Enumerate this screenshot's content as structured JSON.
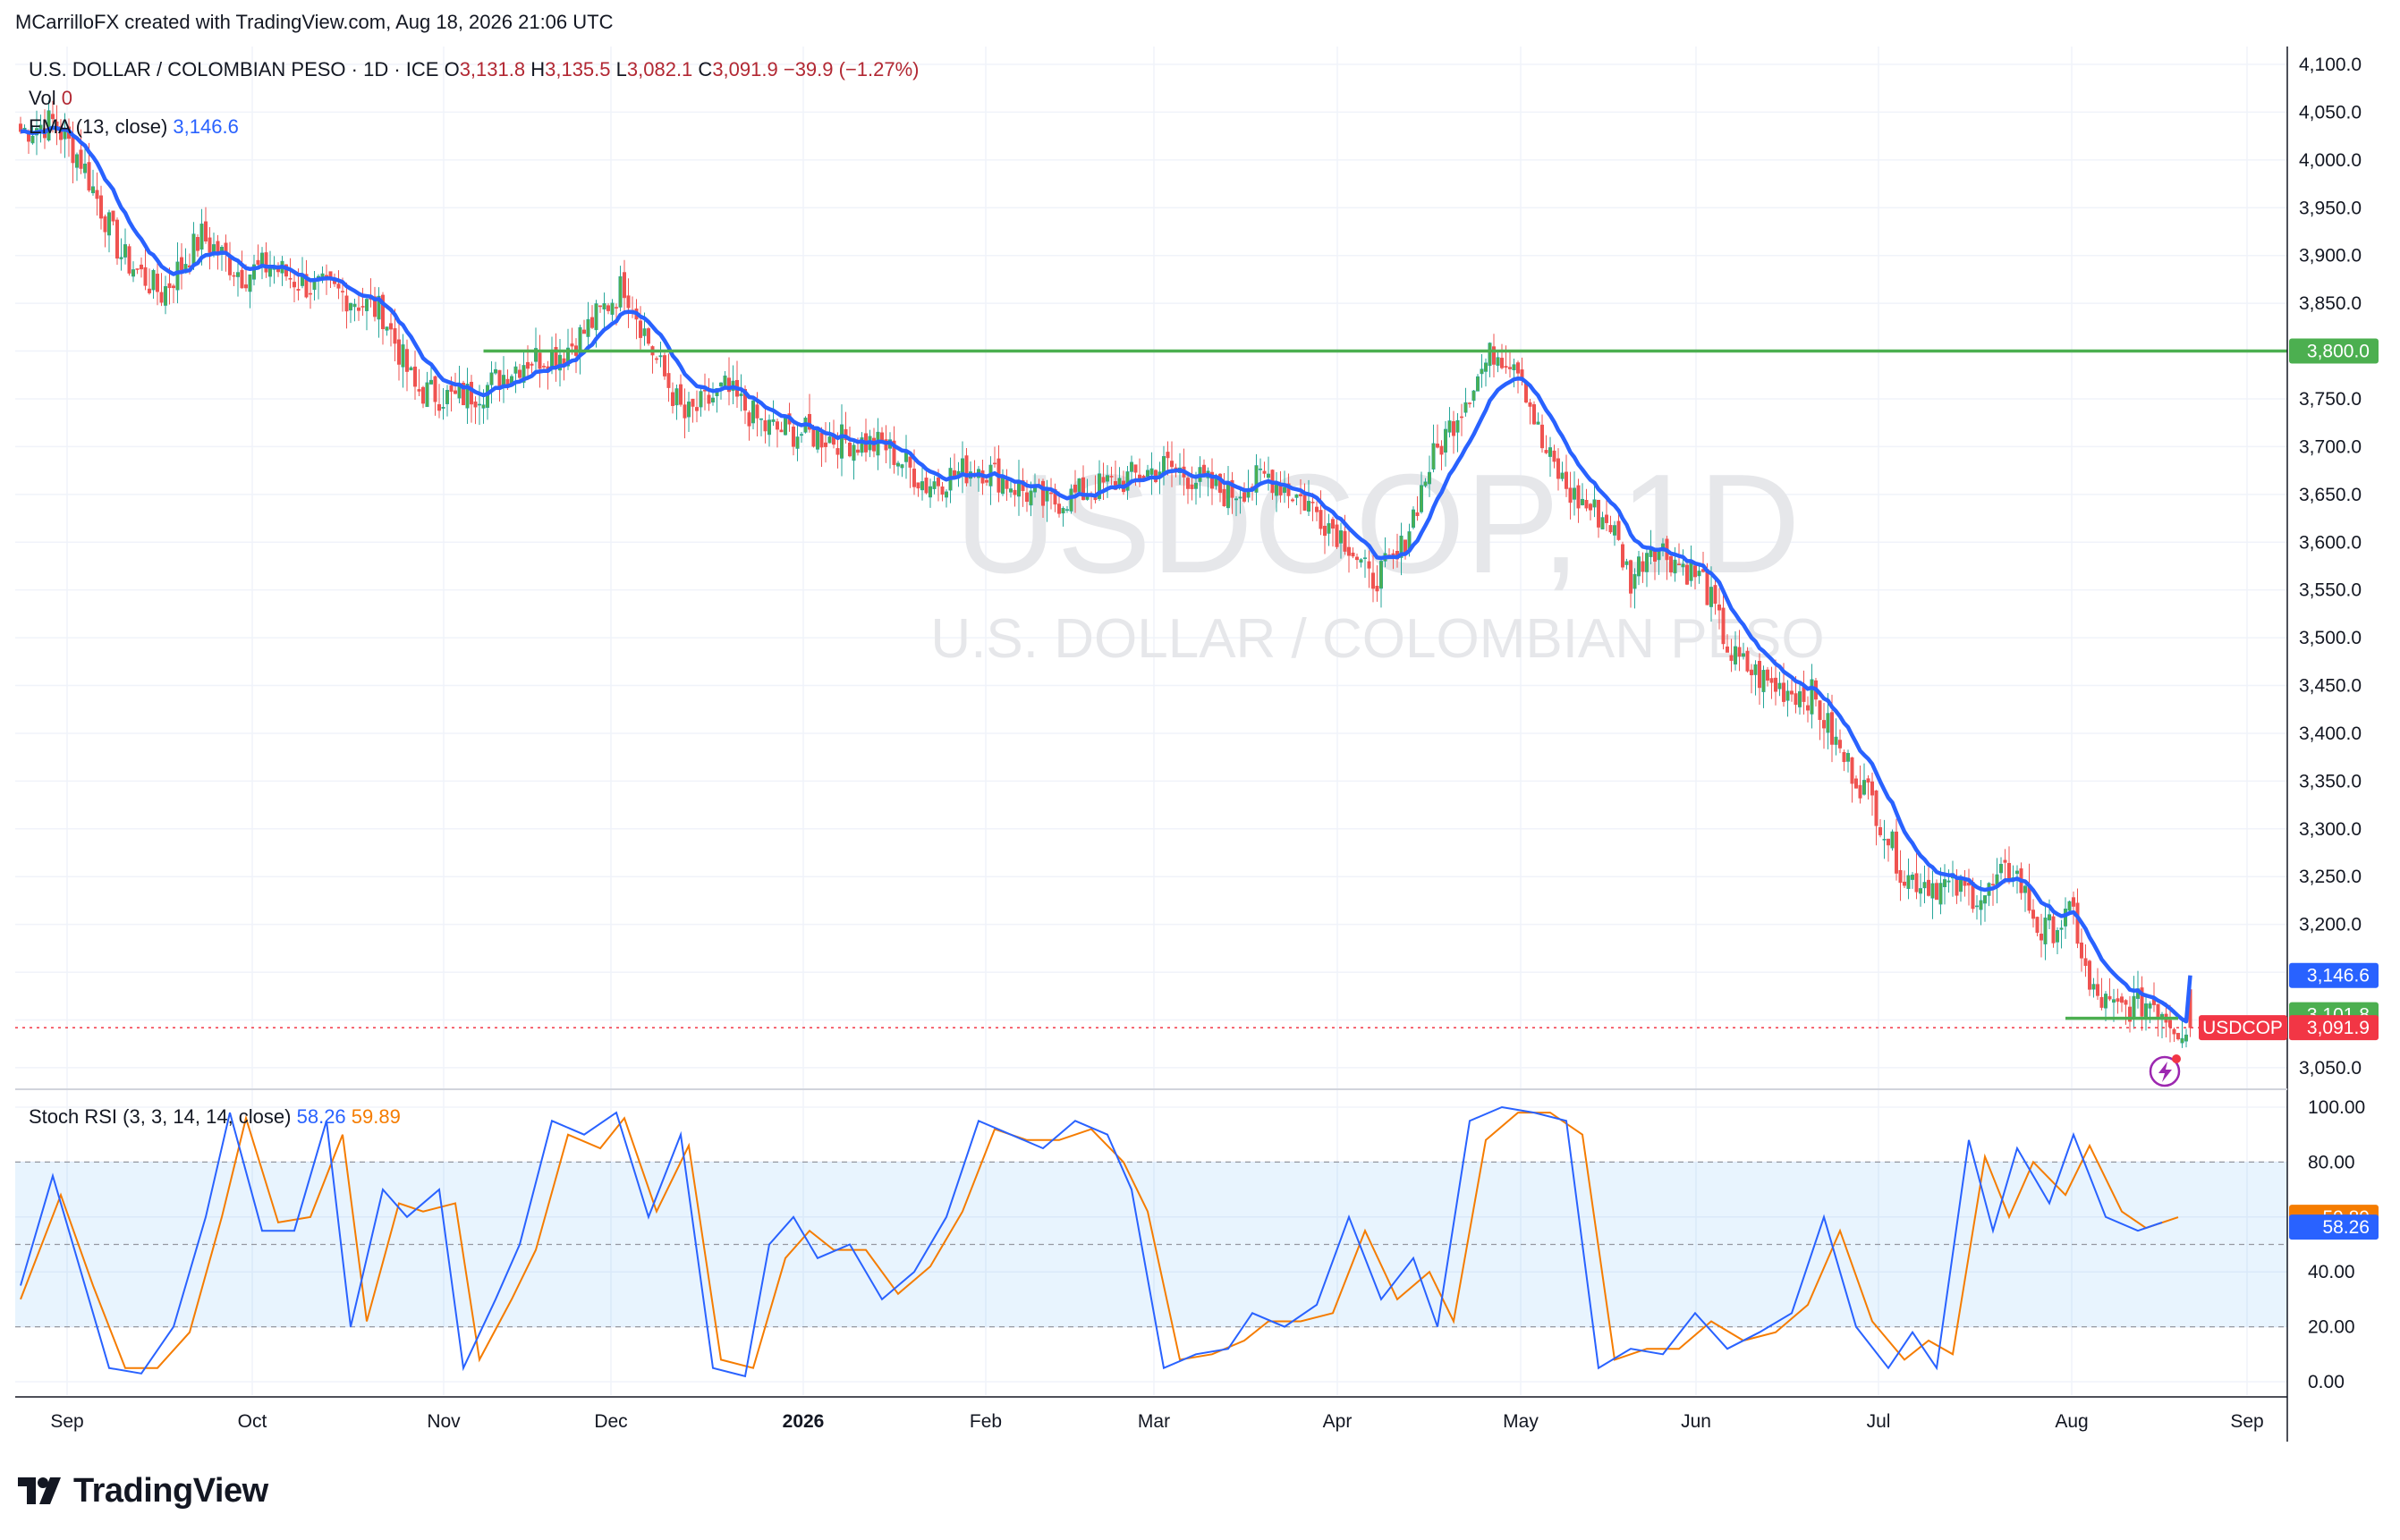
{
  "header": {
    "author_line": "MCarrilloFX created with TradingView.com, Aug 18, 2026 21:06 UTC"
  },
  "legend": {
    "symbol_line": "U.S. DOLLAR / COLOMBIAN PESO · 1D · ICE",
    "open_label": "O",
    "open": "3,131.8",
    "high_label": "H",
    "high": "3,135.5",
    "low_label": "L",
    "low": "3,082.1",
    "close_label": "C",
    "close": "3,091.9",
    "change": "−39.9 (−1.27%)",
    "vol_label": "Vol",
    "vol_value": "0",
    "ema_label": "EMA (13, close)",
    "ema_value": "3,146.6"
  },
  "watermark": {
    "symbol": "USDCOP, 1D",
    "name": "U.S. DOLLAR / COLOMBIAN PESO"
  },
  "price_axis": {
    "ticks": [
      "4,100.0",
      "4,050.0",
      "4,000.0",
      "3,950.0",
      "3,900.0",
      "3,850.0",
      "3,800.0",
      "3,750.0",
      "3,700.0",
      "3,650.0",
      "3,600.0",
      "3,550.0",
      "3,500.0",
      "3,450.0",
      "3,400.0",
      "3,350.0",
      "3,300.0",
      "3,250.0",
      "3,200.0",
      "3,150.0",
      "3,100.0",
      "3,050.0"
    ],
    "resistance_label": "3,800.0",
    "ema_label": "3,146.6",
    "support_label": "3,101.8",
    "price_tag_symbol": "USDCOP",
    "price_tag_value": "3,091.9"
  },
  "stoch": {
    "label": "Stoch RSI (3, 3, 14, 14, close)",
    "k_value": "58.26",
    "d_value": "59.89",
    "ticks": [
      "100.00",
      "80.00",
      "60.00",
      "40.00",
      "20.00",
      "0.00"
    ],
    "k_tag": "58.26",
    "d_tag": "59.89"
  },
  "time_axis": {
    "labels": [
      "Sep",
      "Oct",
      "Nov",
      "Dec",
      "2026",
      "Feb",
      "Mar",
      "Apr",
      "May",
      "Jun",
      "Jul",
      "Aug",
      "Sep"
    ]
  },
  "colors": {
    "up": "#26a69a",
    "up_fill": "#4caf50",
    "down": "#ef5350",
    "ema": "#2962ff",
    "level": "#4caf50",
    "k": "#2962ff",
    "d": "#f57c00",
    "price_tag": "#f23645"
  },
  "brand": "TradingView",
  "chart_data": [
    {
      "type": "candlestick",
      "title": "U.S. DOLLAR / COLOMBIAN PESO · 1D · ICE",
      "xlabel": "",
      "ylabel": "",
      "x_labels": [
        "Sep",
        "Oct",
        "Nov",
        "Dec",
        "2026",
        "Feb",
        "Mar",
        "Apr",
        "May",
        "Jun",
        "Jul",
        "Aug",
        "Sep"
      ],
      "ylim": [
        3018,
        4120
      ],
      "close_path": [
        [
          0,
          4030
        ],
        [
          8,
          4040
        ],
        [
          15,
          4000
        ],
        [
          25,
          3900
        ],
        [
          35,
          3860
        ],
        [
          45,
          3920
        ],
        [
          55,
          3880
        ],
        [
          62,
          3890
        ],
        [
          70,
          3870
        ],
        [
          80,
          3860
        ],
        [
          90,
          3840
        ],
        [
          98,
          3760
        ],
        [
          108,
          3750
        ],
        [
          115,
          3760
        ],
        [
          125,
          3790
        ],
        [
          135,
          3800
        ],
        [
          140,
          3820
        ],
        [
          150,
          3870
        ],
        [
          158,
          3790
        ],
        [
          165,
          3730
        ],
        [
          175,
          3760
        ],
        [
          185,
          3720
        ],
        [
          200,
          3710
        ],
        [
          215,
          3700
        ],
        [
          225,
          3660
        ],
        [
          238,
          3680
        ],
        [
          255,
          3640
        ],
        [
          270,
          3660
        ],
        [
          285,
          3680
        ],
        [
          300,
          3650
        ],
        [
          310,
          3670
        ],
        [
          320,
          3640
        ],
        [
          330,
          3600
        ],
        [
          335,
          3560
        ],
        [
          342,
          3580
        ],
        [
          350,
          3680
        ],
        [
          360,
          3760
        ],
        [
          366,
          3800
        ],
        [
          372,
          3790
        ],
        [
          378,
          3700
        ],
        [
          385,
          3650
        ],
        [
          395,
          3620
        ],
        [
          400,
          3560
        ],
        [
          405,
          3600
        ],
        [
          418,
          3560
        ],
        [
          425,
          3480
        ],
        [
          435,
          3450
        ],
        [
          445,
          3440
        ],
        [
          452,
          3380
        ],
        [
          460,
          3330
        ],
        [
          468,
          3250
        ],
        [
          478,
          3240
        ],
        [
          488,
          3230
        ],
        [
          495,
          3260
        ],
        [
          502,
          3190
        ],
        [
          510,
          3210
        ],
        [
          514,
          3130
        ],
        [
          520,
          3110
        ],
        [
          530,
          3120
        ],
        [
          536,
          3092
        ]
      ],
      "ema_13": {
        "last": 3146.6
      },
      "last": {
        "open": 3131.8,
        "high": 3135.5,
        "low": 3082.1,
        "close": 3091.9,
        "change": -39.9,
        "change_pct": -1.27
      },
      "levels": [
        {
          "name": "resistance",
          "value": 3800.0
        },
        {
          "name": "support",
          "value": 3101.8
        }
      ]
    },
    {
      "type": "line",
      "title": "Stoch RSI (3, 3, 14, 14, close)",
      "ylim": [
        0,
        100
      ],
      "bands": [
        20,
        50,
        80
      ],
      "series": [
        {
          "name": "K",
          "last": 58.26,
          "values": [
            [
              0,
              35
            ],
            [
              8,
              75
            ],
            [
              14,
              45
            ],
            [
              22,
              5
            ],
            [
              30,
              3
            ],
            [
              38,
              20
            ],
            [
              46,
              60
            ],
            [
              52,
              98
            ],
            [
              60,
              55
            ],
            [
              68,
              55
            ],
            [
              76,
              95
            ],
            [
              82,
              20
            ],
            [
              90,
              70
            ],
            [
              96,
              60
            ],
            [
              104,
              70
            ],
            [
              110,
              5
            ],
            [
              118,
              30
            ],
            [
              124,
              50
            ],
            [
              132,
              95
            ],
            [
              140,
              90
            ],
            [
              148,
              98
            ],
            [
              156,
              60
            ],
            [
              164,
              90
            ],
            [
              172,
              5
            ],
            [
              180,
              2
            ],
            [
              186,
              50
            ],
            [
              192,
              60
            ],
            [
              198,
              45
            ],
            [
              206,
              50
            ],
            [
              214,
              30
            ],
            [
              222,
              40
            ],
            [
              230,
              60
            ],
            [
              238,
              95
            ],
            [
              246,
              90
            ],
            [
              254,
              85
            ],
            [
              262,
              95
            ],
            [
              270,
              90
            ],
            [
              276,
              70
            ],
            [
              284,
              5
            ],
            [
              292,
              10
            ],
            [
              300,
              12
            ],
            [
              306,
              25
            ],
            [
              314,
              20
            ],
            [
              322,
              28
            ],
            [
              330,
              60
            ],
            [
              338,
              30
            ],
            [
              346,
              45
            ],
            [
              352,
              20
            ],
            [
              360,
              95
            ],
            [
              368,
              100
            ],
            [
              376,
              98
            ],
            [
              384,
              95
            ],
            [
              392,
              5
            ],
            [
              400,
              12
            ],
            [
              408,
              10
            ],
            [
              416,
              25
            ],
            [
              424,
              12
            ],
            [
              432,
              18
            ],
            [
              440,
              25
            ],
            [
              448,
              60
            ],
            [
              456,
              20
            ],
            [
              464,
              5
            ],
            [
              470,
              18
            ],
            [
              476,
              5
            ],
            [
              484,
              88
            ],
            [
              490,
              55
            ],
            [
              496,
              85
            ],
            [
              504,
              65
            ],
            [
              510,
              90
            ],
            [
              518,
              60
            ],
            [
              526,
              55
            ],
            [
              532,
              58
            ]
          ]
        },
        {
          "name": "D",
          "last": 59.89,
          "values": [
            [
              0,
              30
            ],
            [
              10,
              68
            ],
            [
              18,
              35
            ],
            [
              26,
              5
            ],
            [
              34,
              5
            ],
            [
              42,
              18
            ],
            [
              50,
              60
            ],
            [
              56,
              96
            ],
            [
              64,
              58
            ],
            [
              72,
              60
            ],
            [
              80,
              90
            ],
            [
              86,
              22
            ],
            [
              94,
              65
            ],
            [
              100,
              62
            ],
            [
              108,
              65
            ],
            [
              114,
              8
            ],
            [
              122,
              30
            ],
            [
              128,
              48
            ],
            [
              136,
              90
            ],
            [
              144,
              85
            ],
            [
              150,
              96
            ],
            [
              158,
              62
            ],
            [
              166,
              86
            ],
            [
              174,
              8
            ],
            [
              182,
              5
            ],
            [
              190,
              45
            ],
            [
              196,
              55
            ],
            [
              202,
              48
            ],
            [
              210,
              48
            ],
            [
              218,
              32
            ],
            [
              226,
              42
            ],
            [
              234,
              62
            ],
            [
              242,
              92
            ],
            [
              250,
              88
            ],
            [
              258,
              88
            ],
            [
              266,
              92
            ],
            [
              274,
              80
            ],
            [
              280,
              62
            ],
            [
              288,
              8
            ],
            [
              296,
              10
            ],
            [
              304,
              15
            ],
            [
              310,
              22
            ],
            [
              318,
              22
            ],
            [
              326,
              25
            ],
            [
              334,
              55
            ],
            [
              342,
              30
            ],
            [
              350,
              40
            ],
            [
              356,
              22
            ],
            [
              364,
              88
            ],
            [
              372,
              98
            ],
            [
              380,
              98
            ],
            [
              388,
              90
            ],
            [
              396,
              8
            ],
            [
              404,
              12
            ],
            [
              412,
              12
            ],
            [
              420,
              22
            ],
            [
              428,
              15
            ],
            [
              436,
              18
            ],
            [
              444,
              28
            ],
            [
              452,
              55
            ],
            [
              460,
              22
            ],
            [
              468,
              8
            ],
            [
              474,
              15
            ],
            [
              480,
              10
            ],
            [
              488,
              82
            ],
            [
              494,
              60
            ],
            [
              500,
              80
            ],
            [
              508,
              68
            ],
            [
              514,
              86
            ],
            [
              522,
              62
            ],
            [
              528,
              56
            ],
            [
              536,
              59.89
            ]
          ]
        }
      ]
    }
  ]
}
